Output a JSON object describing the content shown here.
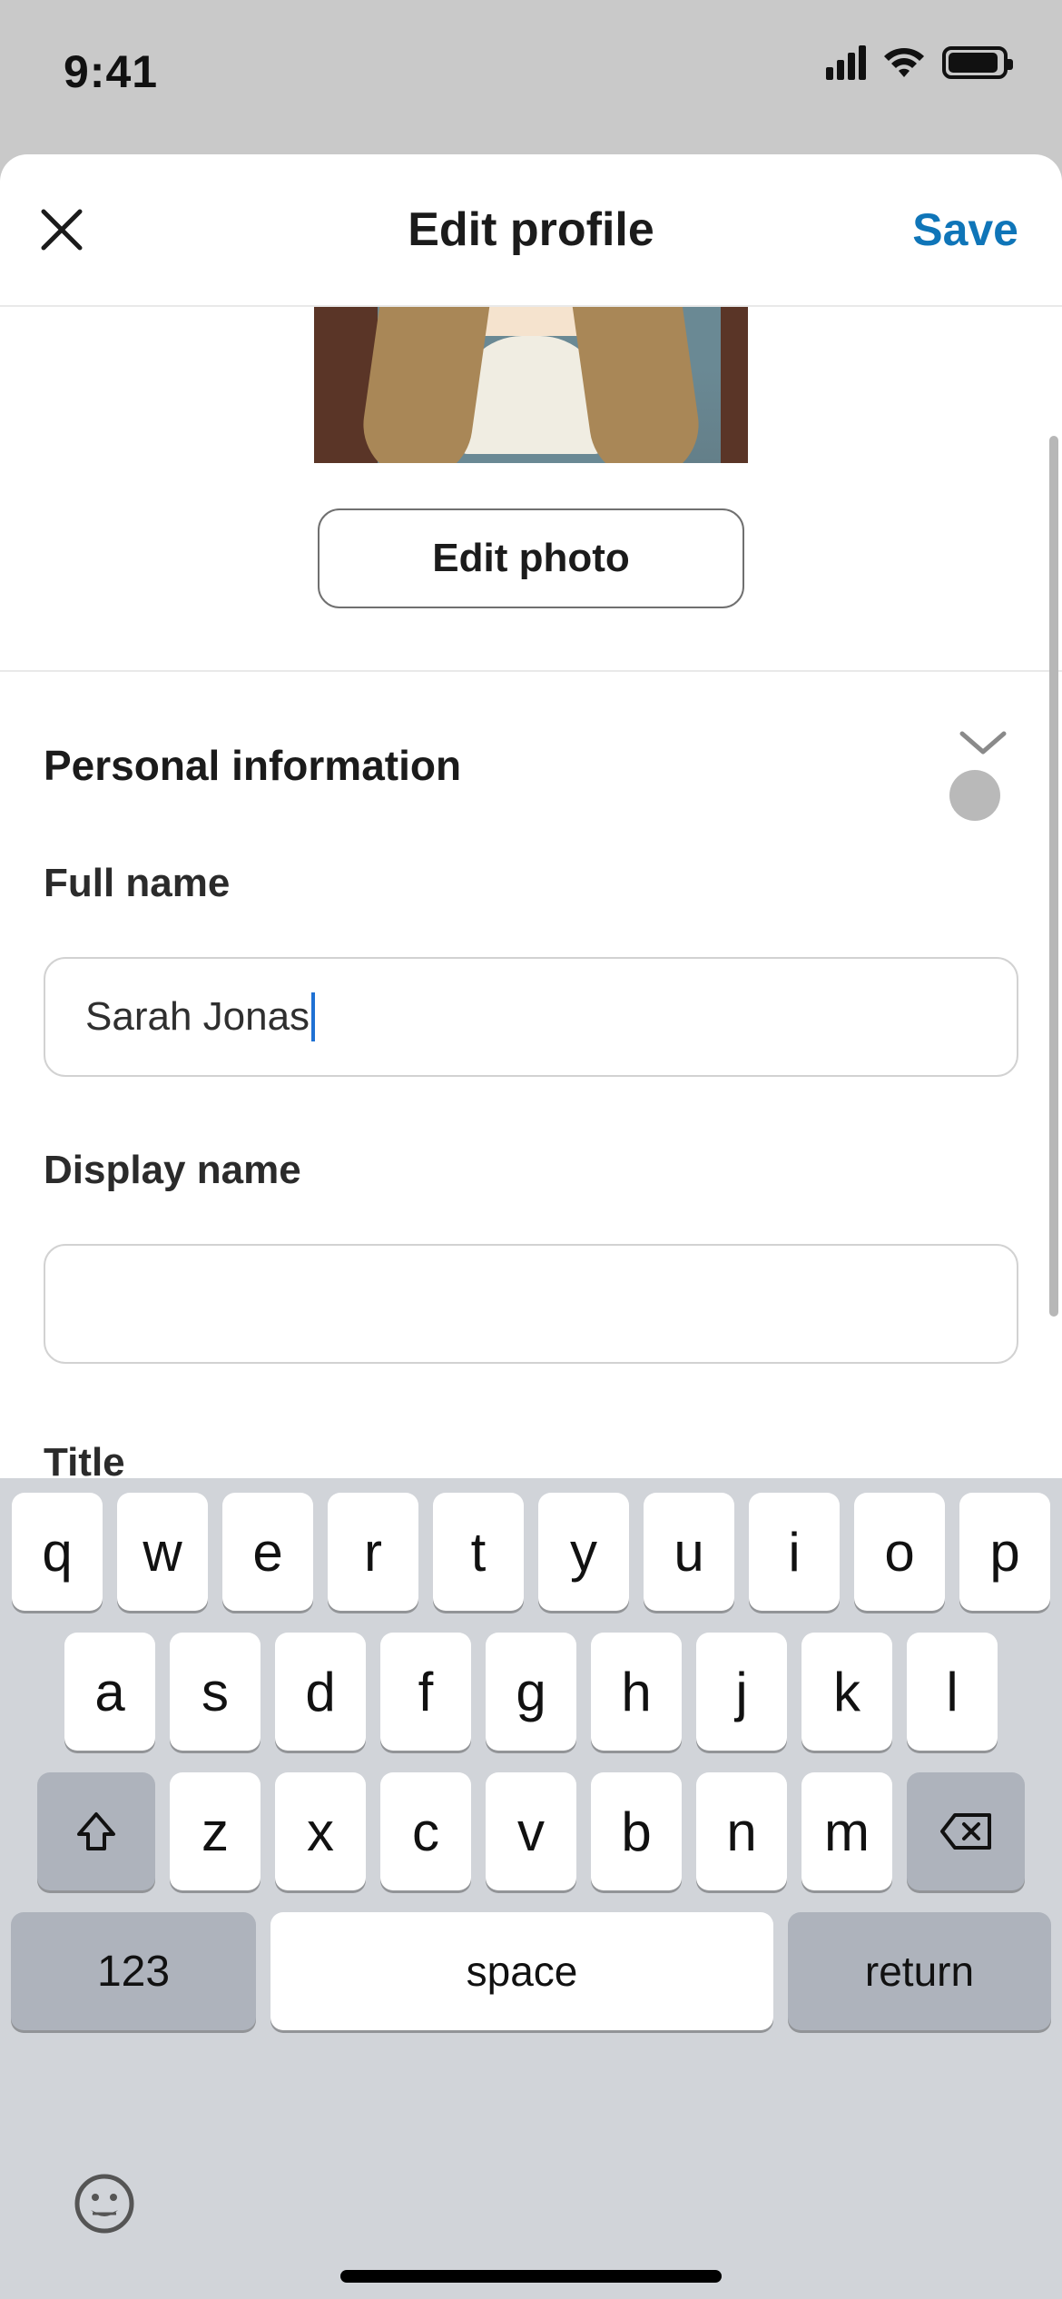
{
  "status": {
    "time": "9:41"
  },
  "header": {
    "title": "Edit profile",
    "save_label": "Save"
  },
  "photo": {
    "edit_label": "Edit photo"
  },
  "section": {
    "title": "Personal information"
  },
  "fields": {
    "full_name_label": "Full name",
    "full_name_value": "Sarah Jonas",
    "display_name_label": "Display name",
    "display_name_value": "",
    "title_label": "Title"
  },
  "keyboard": {
    "row1": [
      "q",
      "w",
      "e",
      "r",
      "t",
      "y",
      "u",
      "i",
      "o",
      "p"
    ],
    "row2": [
      "a",
      "s",
      "d",
      "f",
      "g",
      "h",
      "j",
      "k",
      "l"
    ],
    "row3": [
      "z",
      "x",
      "c",
      "v",
      "b",
      "n",
      "m"
    ],
    "numbers_label": "123",
    "space_label": "space",
    "return_label": "return"
  }
}
